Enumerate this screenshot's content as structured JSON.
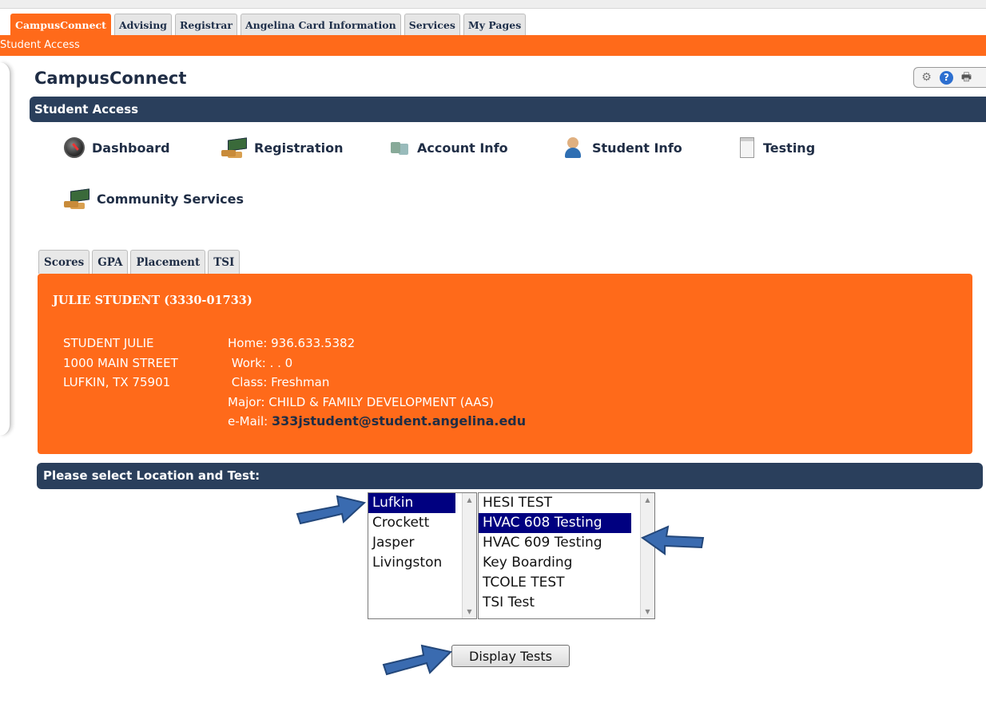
{
  "top_tabs": [
    {
      "label": "CampusConnect",
      "active": true
    },
    {
      "label": "Advising"
    },
    {
      "label": "Registrar"
    },
    {
      "label": "Angelina Card Information"
    },
    {
      "label": "Services"
    },
    {
      "label": "My Pages"
    }
  ],
  "subheader": "Student Access",
  "page_title": "CampusConnect",
  "section_title": "Student Access",
  "nav": {
    "dashboard": "Dashboard",
    "registration": "Registration",
    "account_info": "Account Info",
    "student_info": "Student Info",
    "testing": "Testing",
    "community_services": "Community Services"
  },
  "sub_tabs": [
    "Scores",
    "GPA",
    "Placement",
    "TSI"
  ],
  "student": {
    "header": "JULIE STUDENT (3330-01733)",
    "address": [
      "STUDENT JULIE",
      "1000 MAIN STREET",
      "LUFKIN, TX  75901"
    ],
    "home_label": "Home:",
    "home": "936.633.5382",
    "work_label": "Work:",
    "work": ". . 0",
    "class_label": "Class:",
    "class": "Freshman",
    "major_label": "Major:",
    "major": "CHILD & FAMILY DEVELOPMENT (AAS)",
    "email_label": "e-Mail:",
    "email": "333jstudent@student.angelina.edu"
  },
  "select_header": "Please select Location and Test:",
  "locations": {
    "options": [
      "Lufkin",
      "Crockett",
      "Jasper",
      "Livingston"
    ],
    "selected": "Lufkin"
  },
  "tests": {
    "options": [
      "HESI TEST",
      "HVAC 608 Testing",
      "HVAC 609 Testing",
      "Key Boarding",
      "TCOLE TEST",
      "TSI Test"
    ],
    "selected": "HVAC 608 Testing"
  },
  "display_button": "Display Tests",
  "colors": {
    "accent_orange": "#ff6a1a",
    "header_navy": "#2a3f5c",
    "selection": "#000080",
    "arrow": "#3a6bb0"
  }
}
